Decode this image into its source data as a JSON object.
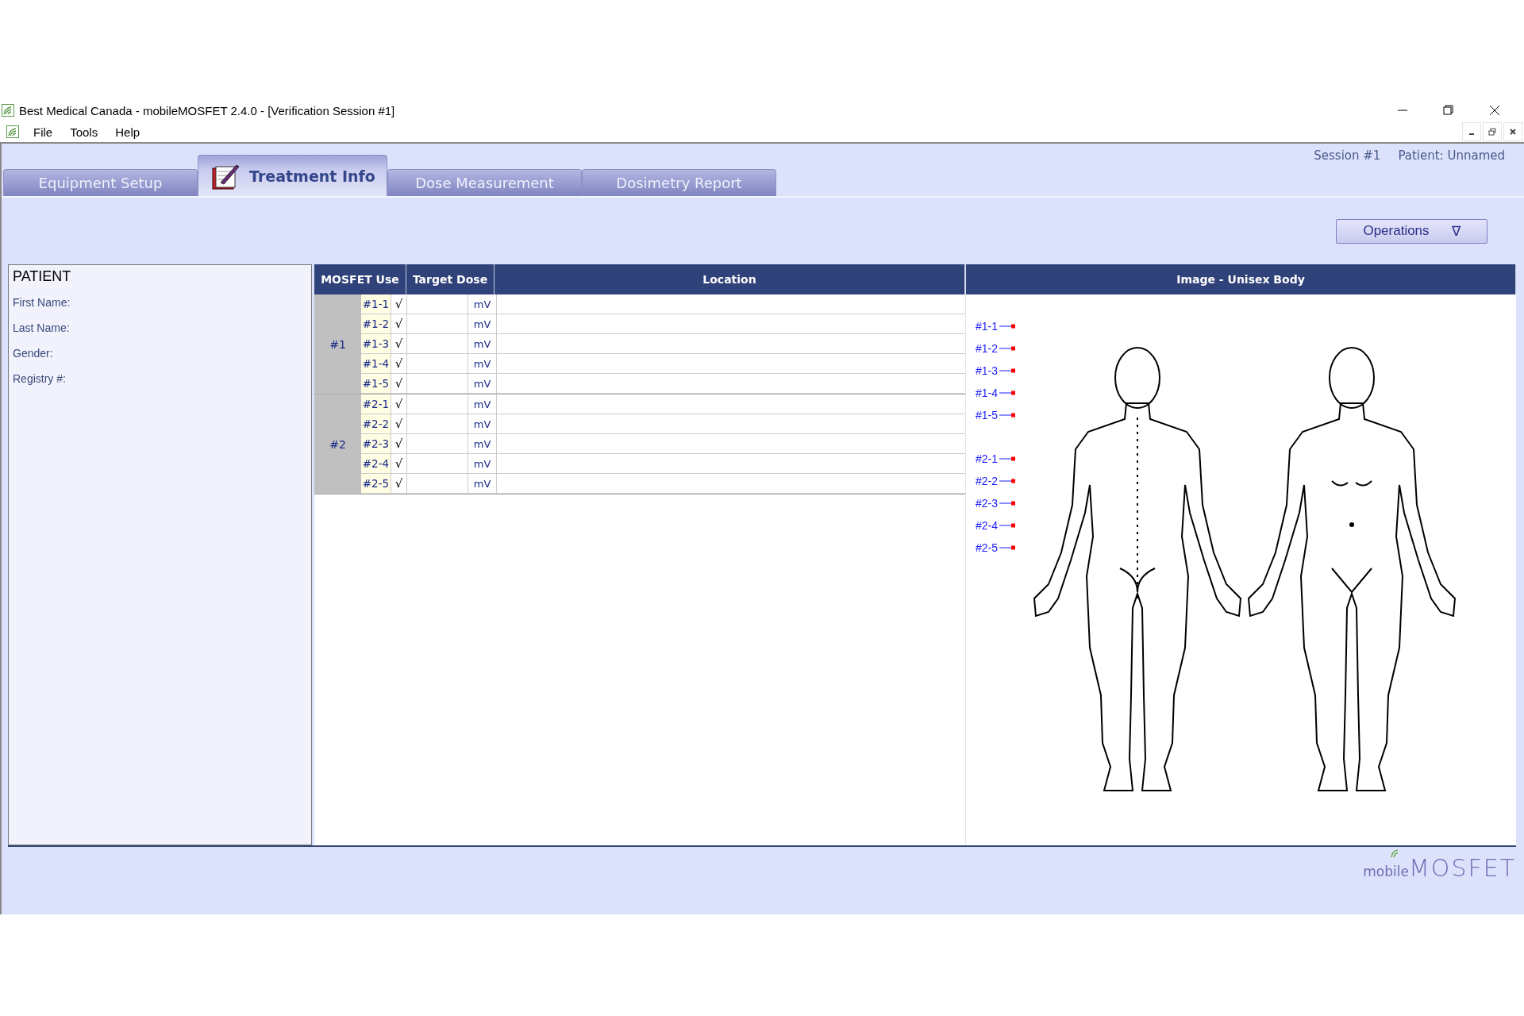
{
  "window": {
    "title": "Best Medical Canada - mobileMOSFET 2.4.0 - [Verification Session #1]"
  },
  "menu": [
    "File",
    "Tools",
    "Help"
  ],
  "tabs": [
    {
      "label": "Equipment Setup",
      "selected": false
    },
    {
      "label": "Treatment Info",
      "selected": true
    },
    {
      "label": "Dose Measurement",
      "selected": false
    },
    {
      "label": "Dosimetry Report",
      "selected": false
    }
  ],
  "session": "Session #1",
  "patient_status": "Patient: Unnamed",
  "operations_button": {
    "label": "Operations",
    "caret": "∇"
  },
  "patient_panel": {
    "title": "PATIENT",
    "fields": [
      "First Name:",
      "Last Name:",
      "Gender:",
      "Registry #:"
    ]
  },
  "table": {
    "columns": [
      "MOSFET Use",
      "Target Dose",
      "Location"
    ],
    "groups": [
      {
        "label": "#1",
        "rows": [
          {
            "sensor": "#1-1",
            "used": true,
            "mark": "√",
            "unit": "mV"
          },
          {
            "sensor": "#1-2",
            "used": true,
            "mark": "√",
            "unit": "mV"
          },
          {
            "sensor": "#1-3",
            "used": true,
            "mark": "√",
            "unit": "mV"
          },
          {
            "sensor": "#1-4",
            "used": true,
            "mark": "√",
            "unit": "mV"
          },
          {
            "sensor": "#1-5",
            "used": true,
            "mark": "√",
            "unit": "mV"
          }
        ]
      },
      {
        "label": "#2",
        "rows": [
          {
            "sensor": "#2-1",
            "used": true,
            "mark": "√",
            "unit": "mV"
          },
          {
            "sensor": "#2-2",
            "used": true,
            "mark": "√",
            "unit": "mV"
          },
          {
            "sensor": "#2-3",
            "used": true,
            "mark": "√",
            "unit": "mV"
          },
          {
            "sensor": "#2-4",
            "used": true,
            "mark": "√",
            "unit": "mV"
          },
          {
            "sensor": "#2-5",
            "used": true,
            "mark": "√",
            "unit": "mV"
          }
        ]
      }
    ]
  },
  "image_panel": {
    "title": "Image - Unisex Body",
    "marker_groups": [
      [
        "#1-1",
        "#1-2",
        "#1-3",
        "#1-4",
        "#1-5"
      ],
      [
        "#2-1",
        "#2-2",
        "#2-3",
        "#2-4",
        "#2-5"
      ]
    ]
  },
  "logo": {
    "prefix": "mobile",
    "name": "MOSFET"
  }
}
